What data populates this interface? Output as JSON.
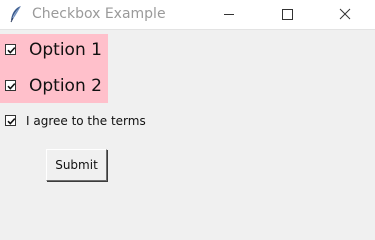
{
  "window": {
    "title": "Checkbox Example",
    "buttons": {
      "minimize_icon": "minimize-icon",
      "maximize_icon": "maximize-icon",
      "close_icon": "close-icon"
    }
  },
  "checkboxes": [
    {
      "label": "Option 1",
      "checked": true
    },
    {
      "label": "Option 2",
      "checked": true
    },
    {
      "label": "I agree to the terms",
      "checked": true
    }
  ],
  "submit": {
    "label": "Submit"
  },
  "colors": {
    "panel_background": "#ffc0cb",
    "window_background": "#f0f0f0",
    "titlebar_background": "#ffffff",
    "title_text": "#9a9a9a"
  }
}
